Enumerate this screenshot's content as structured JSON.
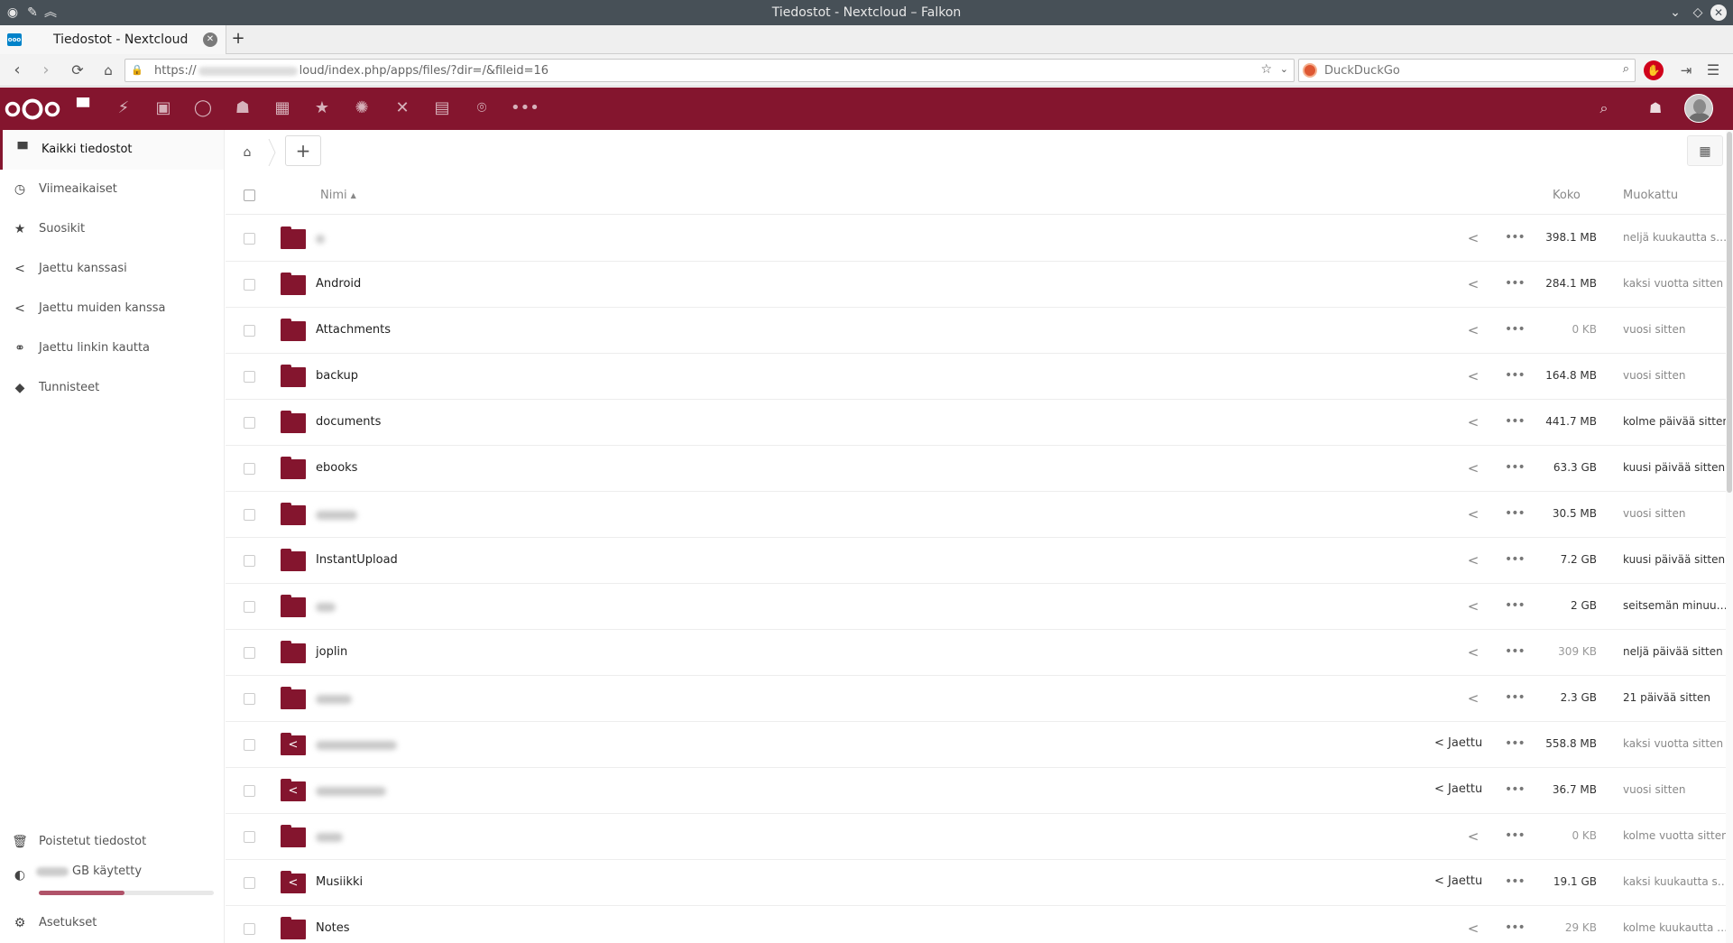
{
  "window": {
    "title": "Tiedostot - Nextcloud – Falkon"
  },
  "browser": {
    "tab_title": "Tiedostot - Nextcloud",
    "url_prefix": "https://",
    "url_suffix": "loud/index.php/apps/files/?dir=/&fileid=16",
    "search_placeholder": "DuckDuckGo"
  },
  "nextcloud": {
    "brand_color": "#84152e",
    "apps": [
      "files-icon",
      "activity-icon",
      "gallery-icon",
      "talk-icon",
      "contacts-icon",
      "calendar-icon",
      "bookmarks-icon",
      "weather-icon",
      "deck-icon",
      "news-icon",
      "maps-icon",
      "more-apps-icon"
    ]
  },
  "sidebar": {
    "items": [
      {
        "label": "Kaikki tiedostot",
        "icon": "folder-icon",
        "active": true
      },
      {
        "label": "Viimeaikaiset",
        "icon": "clock-icon"
      },
      {
        "label": "Suosikit",
        "icon": "star-icon"
      },
      {
        "label": "Jaettu kanssasi",
        "icon": "share-icon"
      },
      {
        "label": "Jaettu muiden kanssa",
        "icon": "share-icon"
      },
      {
        "label": "Jaettu linkin kautta",
        "icon": "link-icon"
      },
      {
        "label": "Tunnisteet",
        "icon": "tag-icon"
      }
    ],
    "deleted": "Poistetut tiedostot",
    "quota_label": "GB käytetty",
    "quota_fraction": 0.49,
    "settings": "Asetukset"
  },
  "table": {
    "col_name": "Nimi",
    "col_size": "Koko",
    "col_modified": "Muokattu",
    "rows": [
      {
        "name": "",
        "blurred": true,
        "blur_w": 10,
        "shared": false,
        "size": "398.1 MB",
        "modified": "neljä kuukautta sitten"
      },
      {
        "name": "Android",
        "shared": false,
        "size": "284.1 MB",
        "modified": "kaksi vuotta sitten"
      },
      {
        "name": "Attachments",
        "shared": false,
        "size": "0 KB",
        "size_light": true,
        "modified": "vuosi sitten"
      },
      {
        "name": "backup",
        "shared": false,
        "size": "164.8 MB",
        "modified": "vuosi sitten"
      },
      {
        "name": "documents",
        "shared": false,
        "size": "441.7 MB",
        "modified": "kolme päivää sitten",
        "mod_dark": true
      },
      {
        "name": "ebooks",
        "shared": false,
        "size": "63.3 GB",
        "modified": "kuusi päivää sitten",
        "mod_dark": true
      },
      {
        "name": "",
        "blurred": true,
        "blur_w": 46,
        "shared": false,
        "size": "30.5 MB",
        "modified": "vuosi sitten"
      },
      {
        "name": "InstantUpload",
        "shared": false,
        "size": "7.2 GB",
        "modified": "kuusi päivää sitten",
        "mod_dark": true
      },
      {
        "name": "",
        "blurred": true,
        "blur_w": 22,
        "shared": false,
        "size": "2 GB",
        "modified": "seitsemän minuuttia sitten",
        "mod_dark": true
      },
      {
        "name": "joplin",
        "shared": false,
        "size": "309 KB",
        "size_light": true,
        "modified": "neljä päivää sitten",
        "mod_dark": true
      },
      {
        "name": "",
        "blurred": true,
        "blur_w": 40,
        "shared": false,
        "size": "2.3 GB",
        "modified": "21 päivää sitten",
        "mod_dark": true
      },
      {
        "name": "",
        "blurred": true,
        "blur_w": 90,
        "shared": true,
        "size": "558.8 MB",
        "modified": "kaksi vuotta sitten"
      },
      {
        "name": "",
        "blurred": true,
        "blur_w": 78,
        "shared": true,
        "size": "36.7 MB",
        "modified": "vuosi sitten"
      },
      {
        "name": "",
        "blurred": true,
        "blur_w": 30,
        "shared": false,
        "size": "0 KB",
        "size_light": true,
        "modified": "kolme vuotta sitten"
      },
      {
        "name": "Musiikki",
        "shared": true,
        "size": "19.1 GB",
        "modified": "kaksi kuukautta sitten"
      },
      {
        "name": "Notes",
        "shared": false,
        "size": "29 KB",
        "size_light": true,
        "modified": "kolme kuukautta sitten"
      }
    ],
    "shared_label": "Jaettu"
  }
}
